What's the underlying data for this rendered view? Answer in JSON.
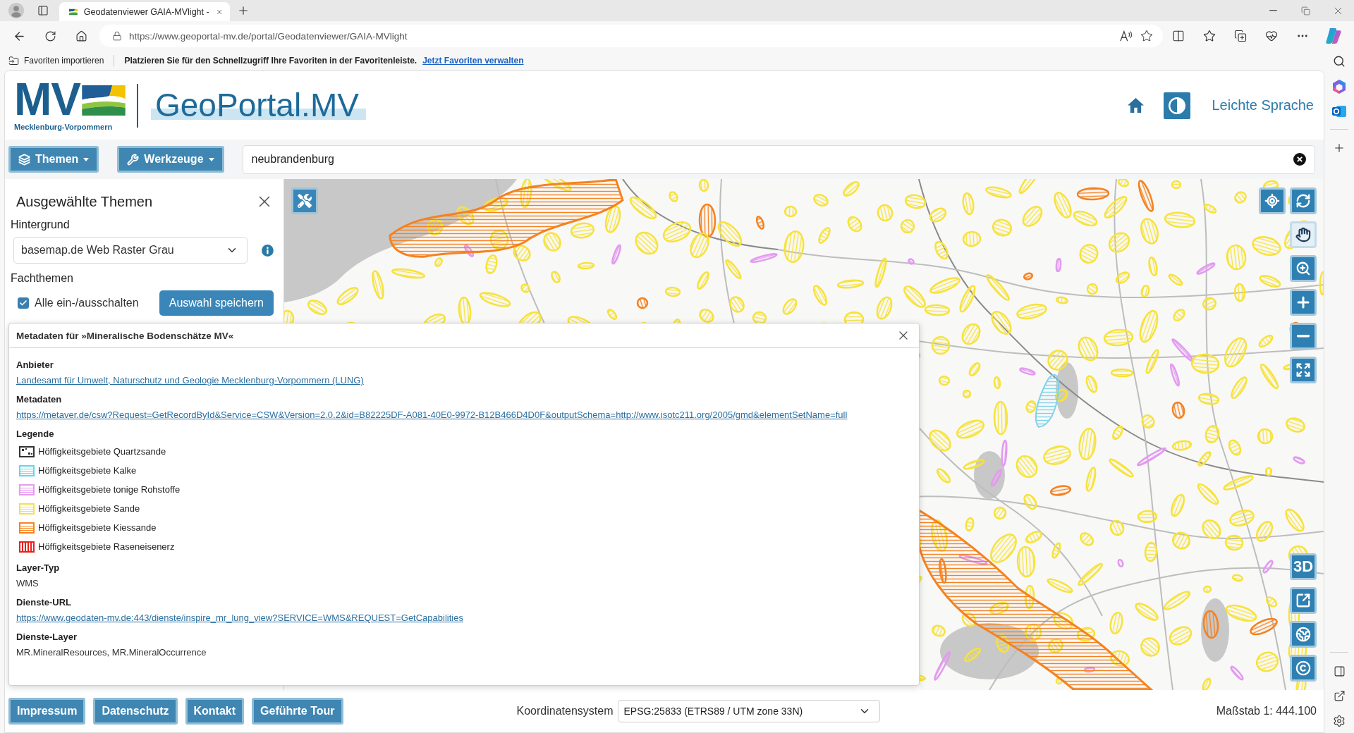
{
  "browser": {
    "tab": {
      "title": "Geodatenviewer GAIA-MVlight -",
      "selected": true
    },
    "address": "https://www.geoportal-mv.de/portal/Geodatenviewer/GAIA-MVlight",
    "favorites_bar": {
      "import_button": "Favoriten importieren",
      "message": "Platzieren Sie für den Schnellzugriff Ihre Favoriten in der Favoritenleiste.",
      "link": "Jetzt Favoriten verwalten"
    }
  },
  "header": {
    "logo_text": "MV",
    "logo_caption": "Mecklenburg-Vorpommern",
    "portal_title": "GeoPortal.MV",
    "easy_language_link": "Leichte Sprache"
  },
  "toolbar": {
    "menus": [
      {
        "kind": "layers",
        "label": "Themen"
      },
      {
        "kind": "tools",
        "label": "Werkzeuge"
      }
    ],
    "search": {
      "value": "neubrandenburg"
    }
  },
  "sidebar": {
    "title": "Ausgewählte Themen",
    "background": {
      "heading": "Hintergrund",
      "select": "basemap.de Web Raster Grau"
    },
    "topics": {
      "heading": "Fachthemen",
      "toggle_all": {
        "label": "Alle ein-/ausschalten",
        "checked": true
      },
      "save_button": "Auswahl speichern"
    }
  },
  "map": {
    "pan_tool": {
      "selected": true
    },
    "view_3d_button": "3D"
  },
  "metadata_dialog": {
    "title": "Metadaten für »Mineralische Bodenschätze MV«",
    "sections": [
      {
        "kind": "link",
        "heading": "Anbieter",
        "text": "Landesamt für Umwelt, Naturschutz und Geologie Mecklenburg-Vorpommern (LUNG)"
      },
      {
        "kind": "link",
        "heading": "Metadaten",
        "text": "https://metaver.de/csw?Request=GetRecordById&Service=CSW&Version=2.0.2&id=B82225DF-A081-40E0-9972-B12B466D4D0F&outputSchema=http://www.isotc211.org/2005/gmd&elementSetName=full"
      },
      {
        "kind": "legend",
        "heading": "Legende",
        "items": [
          {
            "kind": "dots",
            "label": "Höffigkeitsgebiete Quartzsande",
            "color": "#333333"
          },
          {
            "kind": "stripes",
            "label": "Höffigkeitsgebiete Kalke",
            "color": "#5fd8ee"
          },
          {
            "kind": "stripes",
            "label": "Höffigkeitsgebiete tonige Rohstoffe",
            "color": "#e69af0"
          },
          {
            "kind": "stripes",
            "label": "Höffigkeitsgebiete Sande",
            "color": "#f5e04a"
          },
          {
            "kind": "stripes",
            "label": "Höffigkeitsgebiete Kiessande",
            "color": "#f5841f"
          },
          {
            "kind": "bars",
            "label": "Höffigkeitsgebiete Raseneisenerz",
            "color": "#e8201a"
          }
        ]
      },
      {
        "kind": "text",
        "heading": "Layer-Typ",
        "text": "WMS"
      },
      {
        "kind": "link",
        "heading": "Dienste-URL",
        "text": "https://www.geodaten-mv.de:443/dienste/inspire_mr_lung_view?SERVICE=WMS&REQUEST=GetCapabilities"
      },
      {
        "kind": "text",
        "heading": "Dienste-Layer",
        "text": "MR.MineralResources, MR.MineralOccurrence"
      }
    ]
  },
  "footer": {
    "links": [
      "Impressum",
      "Datenschutz",
      "Kontakt",
      "Geführte Tour"
    ],
    "crs_label": "Koordinatensystem",
    "crs_select": "EPSG:25833 (ETRS89 / UTM zone 33N)",
    "scale": "Maßstab 1: 444.100"
  }
}
